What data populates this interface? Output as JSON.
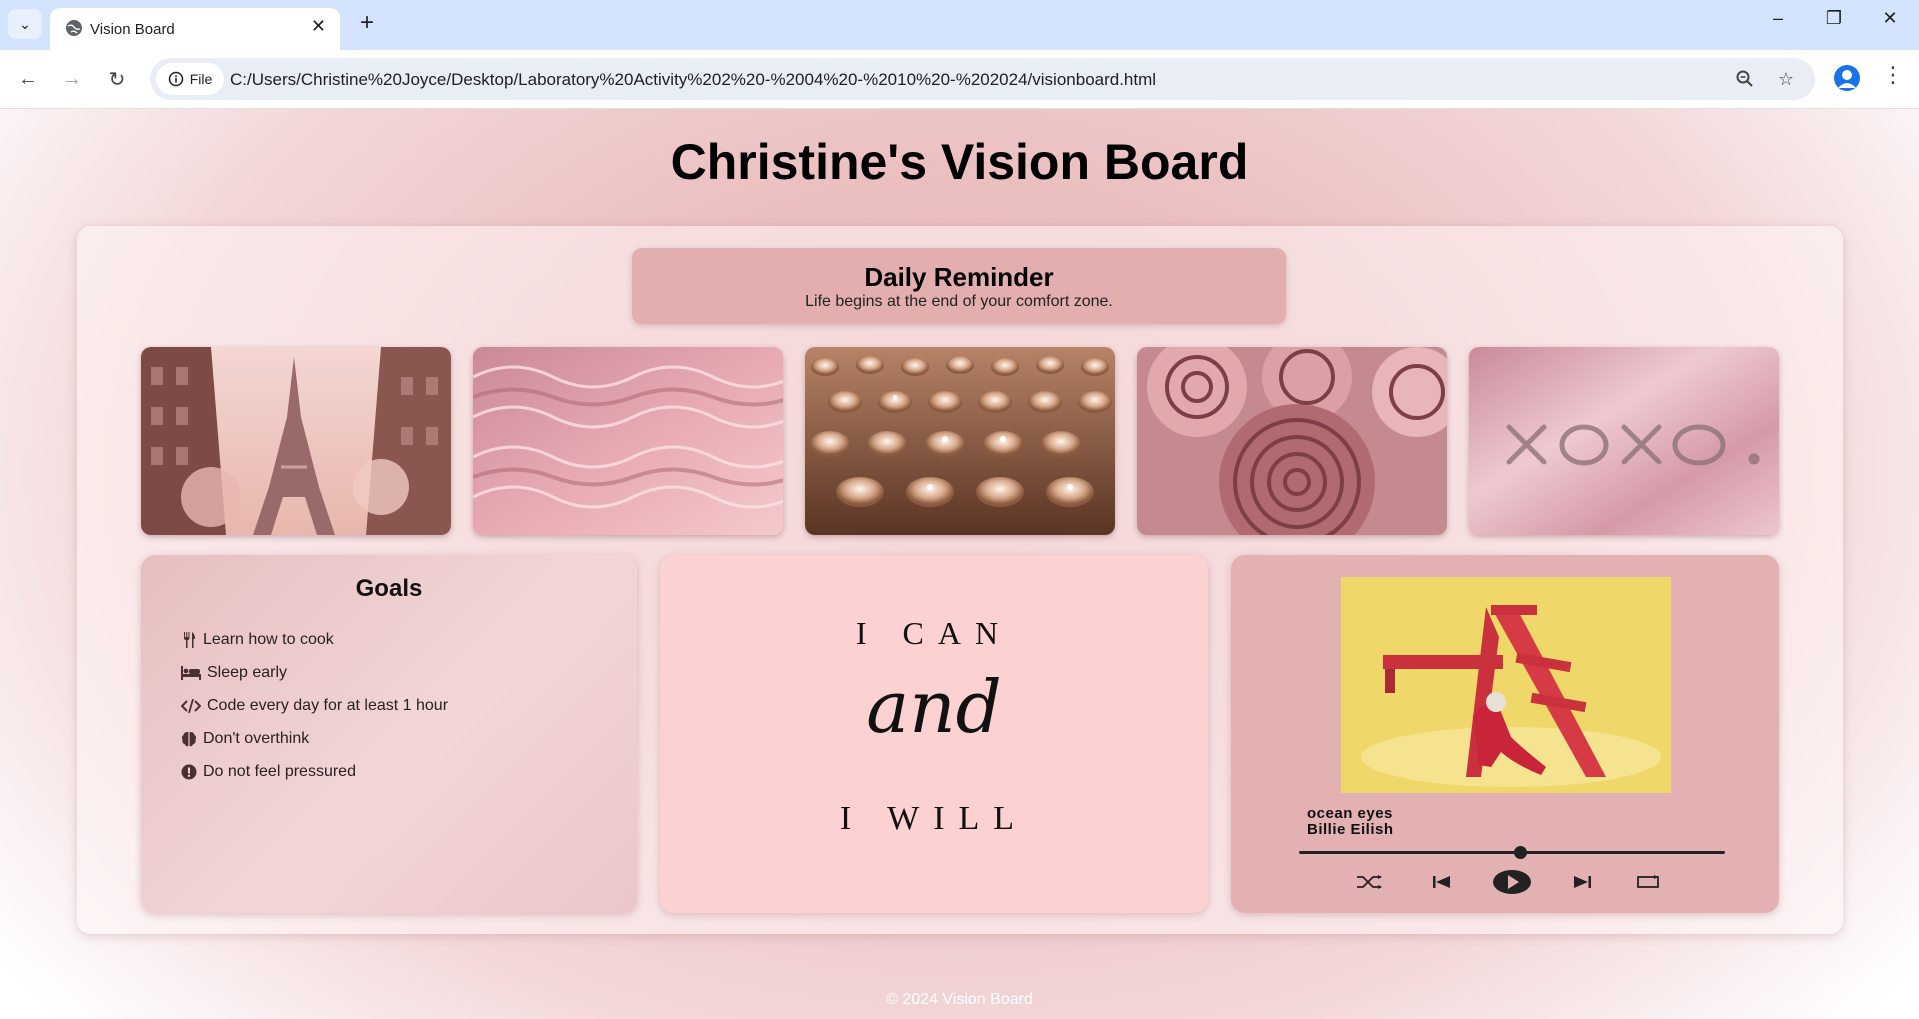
{
  "browser": {
    "tab_title": "Vision Board",
    "file_chip_label": "File",
    "url": "C:/Users/Christine%20Joyce/Desktop/Laboratory%20Activity%202%20-%2004%20-%2010%20-%202024/visionboard.html",
    "icons": [
      "tab-list-icon",
      "globe-icon",
      "close-icon",
      "plus-icon",
      "minimize-icon",
      "restore-icon",
      "window-close-icon",
      "back-icon",
      "forward-icon",
      "reload-icon",
      "info-icon",
      "zoom-icon",
      "star-icon",
      "profile-icon",
      "more-icon"
    ]
  },
  "page": {
    "title": "Christine's Vision Board",
    "reminder": {
      "heading": "Daily Reminder",
      "text": "Life begins at the end of your comfort zone."
    },
    "photos": [
      "eiffel-tower-photo",
      "pink-water-photo",
      "rose-gold-diamonds-photo",
      "pink-roses-photo",
      "xoxo-foil-photo"
    ],
    "goals": {
      "heading": "Goals",
      "items": [
        {
          "icon": "utensils-icon",
          "label": "Learn how to cook"
        },
        {
          "icon": "bed-icon",
          "label": "Sleep early"
        },
        {
          "icon": "code-icon",
          "label": "Code every day for at least 1 hour"
        },
        {
          "icon": "brain-icon",
          "label": "Don't overthink"
        },
        {
          "icon": "exclamation-icon",
          "label": "Do not feel pressured"
        }
      ]
    },
    "quote": {
      "line1": "I CAN",
      "line2": "and",
      "line3": "I WILL"
    },
    "player": {
      "song_title": "ocean eyes",
      "artist": "Billie Eilish",
      "progress": 0.52,
      "controls": [
        "shuffle-icon",
        "previous-icon",
        "play-icon",
        "next-icon",
        "repeat-icon"
      ]
    },
    "footer": "© 2024 Vision Board"
  }
}
